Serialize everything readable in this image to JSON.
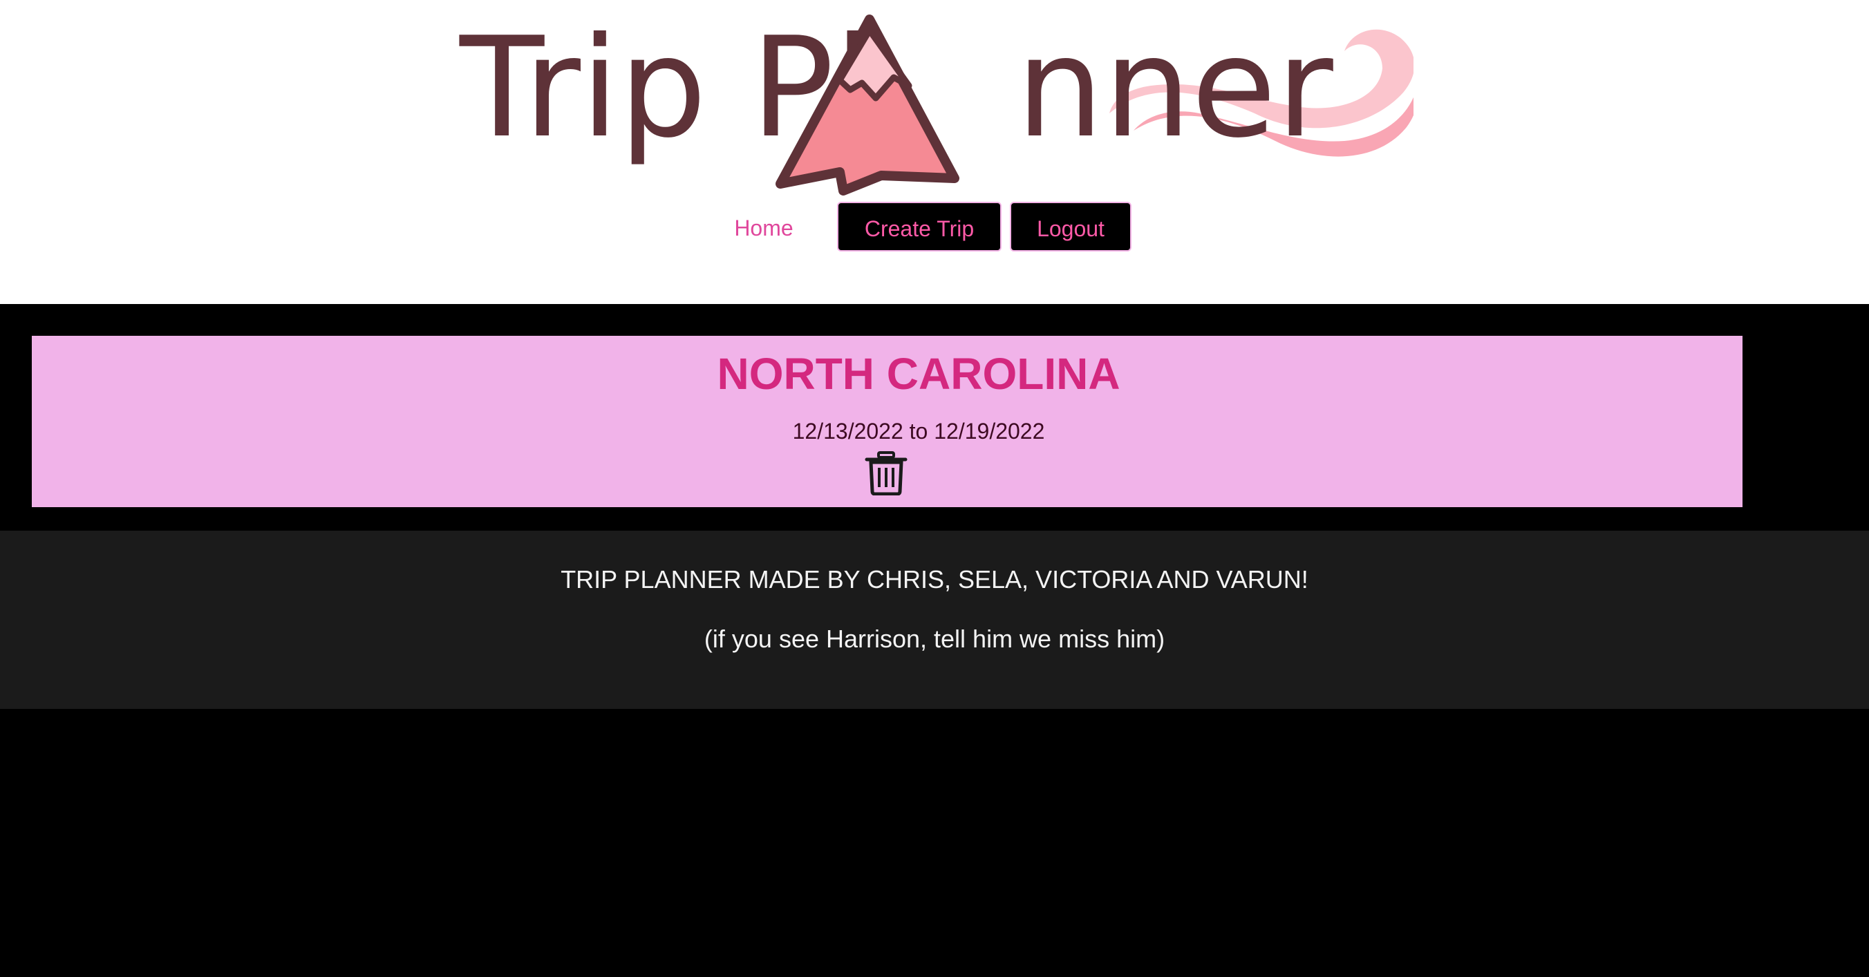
{
  "logo": {
    "text_left": "Trip Pl",
    "text_right": "nner",
    "colors": {
      "text": "#5e3238",
      "mountain": "#f58a94",
      "snow": "#fbc5cd",
      "wave": "#f9a6b4"
    }
  },
  "nav": {
    "home_label": "Home",
    "create_trip_label": "Create Trip",
    "logout_label": "Logout"
  },
  "trip": {
    "title": "NORTH CAROLINA",
    "dates": "12/13/2022 to 12/19/2022",
    "delete_icon": "trash-icon"
  },
  "footer": {
    "credits": "TRIP PLANNER MADE BY CHRIS, SELA, VICTORIA AND VARUN!",
    "note": "(if you see Harrison, tell him we miss him)"
  },
  "colors": {
    "accent_pink": "#e0479c",
    "card_background": "#f1b3e9",
    "footer_background": "#1b1b1b"
  }
}
